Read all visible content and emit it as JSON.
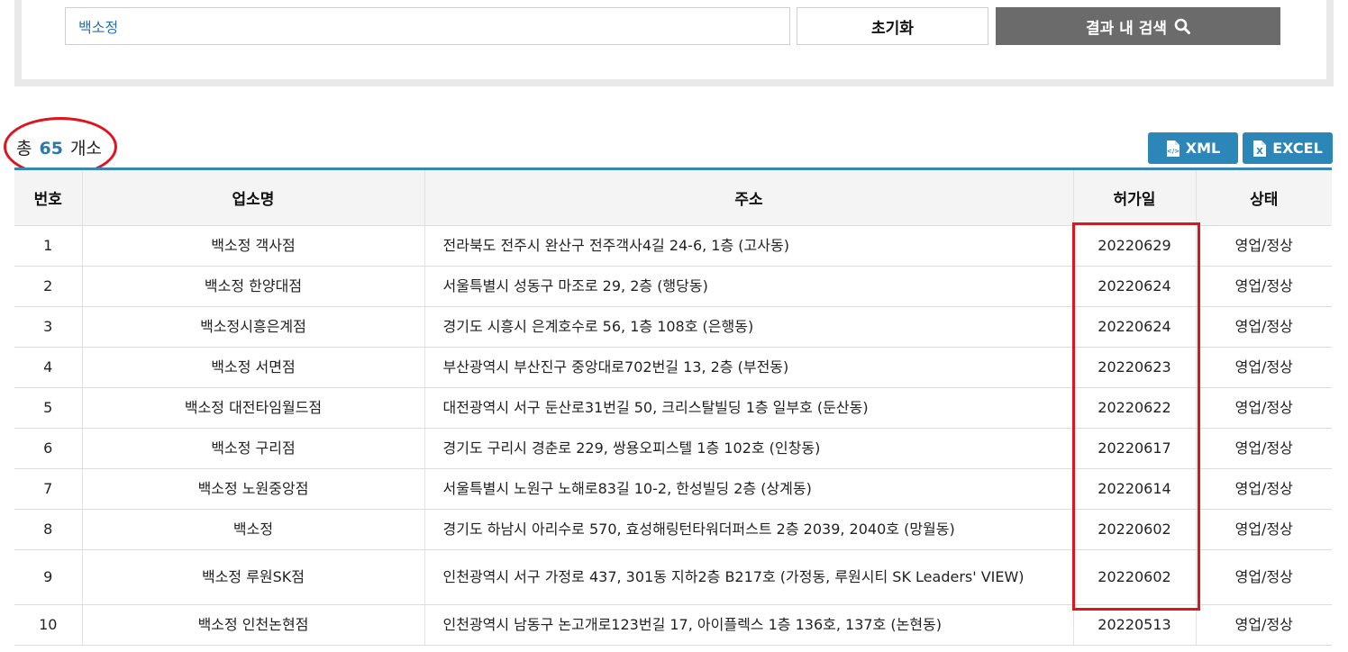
{
  "search": {
    "input_value": "백소정",
    "reset_label": "초기화",
    "search_label": "결과 내 검색"
  },
  "summary": {
    "prefix": "총",
    "count": "65",
    "suffix": "개소"
  },
  "downloads": {
    "xml_label": "XML",
    "excel_label": "EXCEL"
  },
  "table": {
    "headers": [
      "번호",
      "업소명",
      "주소",
      "허가일",
      "상태"
    ],
    "rows": [
      {
        "no": "1",
        "name": "백소정 객사점",
        "address": "전라북도 전주시 완산구 전주객사4길 24-6, 1층 (고사동)",
        "date": "20220629",
        "status": "영업/정상"
      },
      {
        "no": "2",
        "name": "백소정 한양대점",
        "address": "서울특별시 성동구 마조로 29, 2층 (행당동)",
        "date": "20220624",
        "status": "영업/정상"
      },
      {
        "no": "3",
        "name": "백소정시흥은계점",
        "address": "경기도 시흥시 은계호수로 56, 1층 108호 (은행동)",
        "date": "20220624",
        "status": "영업/정상"
      },
      {
        "no": "4",
        "name": "백소정 서면점",
        "address": "부산광역시 부산진구 중앙대로702번길 13, 2층 (부전동)",
        "date": "20220623",
        "status": "영업/정상"
      },
      {
        "no": "5",
        "name": "백소정 대전타임월드점",
        "address": "대전광역시 서구 둔산로31번길 50, 크리스탈빌딩 1층 일부호 (둔산동)",
        "date": "20220622",
        "status": "영업/정상"
      },
      {
        "no": "6",
        "name": "백소정 구리점",
        "address": "경기도 구리시 경춘로 229, 쌍용오피스텔 1층 102호 (인창동)",
        "date": "20220617",
        "status": "영업/정상"
      },
      {
        "no": "7",
        "name": "백소정 노원중앙점",
        "address": "서울특별시 노원구 노해로83길 10-2, 한성빌딩 2층 (상계동)",
        "date": "20220614",
        "status": "영업/정상"
      },
      {
        "no": "8",
        "name": "백소정",
        "address": "경기도 하남시 아리수로 570, 효성해링턴타워더퍼스트 2층 2039, 2040호 (망월동)",
        "date": "20220602",
        "status": "영업/정상"
      },
      {
        "no": "9",
        "name": "백소정 루원SK점",
        "address": "인천광역시 서구 가정로 437, 301동 지하2층 B217호 (가정동, 루원시티 SK Leaders' VIEW)",
        "date": "20220602",
        "status": "영업/정상"
      },
      {
        "no": "10",
        "name": "백소정 인천논현점",
        "address": "인천광역시 남동구 논고개로123번길 17, 아이플렉스 1층 136호, 137호 (논현동)",
        "date": "20220513",
        "status": "영업/정상"
      }
    ]
  },
  "icons": {
    "search": "magnifier-icon",
    "xml": "xml-file-icon",
    "excel": "excel-file-icon"
  },
  "colors": {
    "accent": "#2d86b8",
    "count": "#2b7ba8",
    "search_button": "#6b6b6b",
    "annotation": "#e0141e"
  }
}
